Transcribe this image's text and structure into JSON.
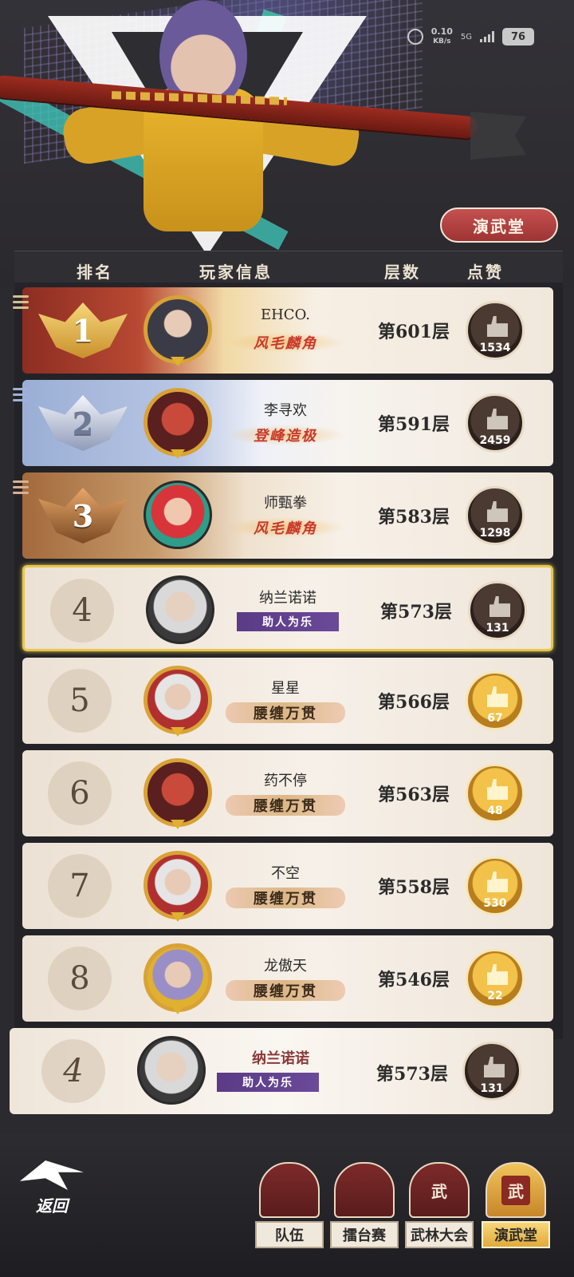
{
  "status_bar": {
    "speed": "0.10",
    "speed_unit": "KB/s",
    "network": "5G",
    "battery": "76"
  },
  "hall_button": "演武堂",
  "table_header": {
    "rank": "排名",
    "player_info": "玩家信息",
    "floor": "层数",
    "likes": "点赞"
  },
  "rows": [
    {
      "rank": "1",
      "name": "EHCO.",
      "title": "风毛麟角",
      "floor": "第601层",
      "likes": "1534"
    },
    {
      "rank": "2",
      "name": "李寻欢",
      "title": "登峰造极",
      "floor": "第591层",
      "likes": "2459"
    },
    {
      "rank": "3",
      "name": "师甄拳",
      "title": "风毛麟角",
      "floor": "第583层",
      "likes": "1298"
    },
    {
      "rank": "4",
      "name": "纳兰诺诺",
      "title": "助人为乐",
      "floor": "第573层",
      "likes": "131"
    },
    {
      "rank": "5",
      "name": "星星",
      "title": "腰缠万贯",
      "floor": "第566层",
      "likes": "67"
    },
    {
      "rank": "6",
      "name": "药不停",
      "title": "腰缠万贯",
      "floor": "第563层",
      "likes": "48"
    },
    {
      "rank": "7",
      "name": "不空",
      "title": "腰缠万贯",
      "floor": "第558层",
      "likes": "530"
    },
    {
      "rank": "8",
      "name": "龙傲天",
      "title": "腰缠万贯",
      "floor": "第546层",
      "likes": "22"
    }
  ],
  "my_rank": {
    "rank": "4",
    "name": "纳兰诺诺",
    "title": "助人为乐",
    "floor": "第573层",
    "likes": "131"
  },
  "back_label": "返回",
  "tabs": [
    {
      "label": "队伍",
      "icon_text": ""
    },
    {
      "label": "擂台赛",
      "icon_text": ""
    },
    {
      "label": "武林大会",
      "icon_text": "武"
    },
    {
      "label": "演武堂",
      "icon_text": "武"
    }
  ]
}
